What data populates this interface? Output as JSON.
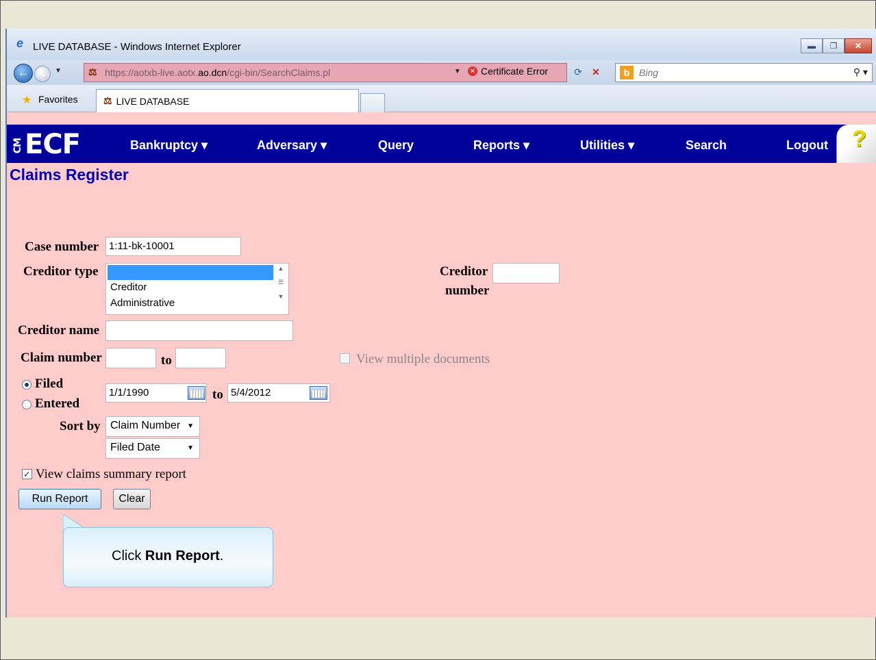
{
  "window": {
    "title": "LIVE DATABASE - Windows Internet Explorer",
    "buttons": [
      "minimize",
      "maximize",
      "close"
    ]
  },
  "addressbar": {
    "url_prefix": "https://aotxb-live.aotx.",
    "url_domain": "ao.dcn",
    "url_path": "/cgi-bin/SearchClaims.pl",
    "cert_error": "Certificate Error",
    "search_engine": "Bing"
  },
  "favorites": {
    "label": "Favorites",
    "tab_title": "LIVE DATABASE"
  },
  "nav": {
    "logo": "ECF",
    "logo_prefix": "CM",
    "items": [
      "Bankruptcy",
      "Adversary",
      "Query",
      "Reports",
      "Utilities",
      "Search",
      "Logout"
    ],
    "help": "?"
  },
  "page": {
    "title": "Claims Register"
  },
  "form": {
    "case_number_label": "Case number",
    "case_number_value": "1:11-bk-10001",
    "creditor_type_label": "Creditor type",
    "creditor_type_options": [
      "",
      "Creditor",
      "Administrative"
    ],
    "creditor_number_label_1": "Creditor",
    "creditor_number_label_2": "number",
    "creditor_number_value": "",
    "creditor_name_label": "Creditor name",
    "creditor_name_value": "",
    "claim_number_label": "Claim number",
    "claim_from": "",
    "to_label": "to",
    "claim_to": "",
    "view_multiple_label": "View multiple documents",
    "filed_label": "Filed",
    "entered_label": "Entered",
    "date_from": "1/1/1990",
    "date_to": "5/4/2012",
    "sort_by_label": "Sort by",
    "sort_primary": "Claim Number",
    "sort_secondary": "Filed Date",
    "summary_label": "View claims summary report",
    "summary_checked": true,
    "run_report": "Run Report",
    "clear": "Clear"
  },
  "callout": {
    "prefix": "Click ",
    "emphasis": "Run Report",
    "suffix": "."
  }
}
